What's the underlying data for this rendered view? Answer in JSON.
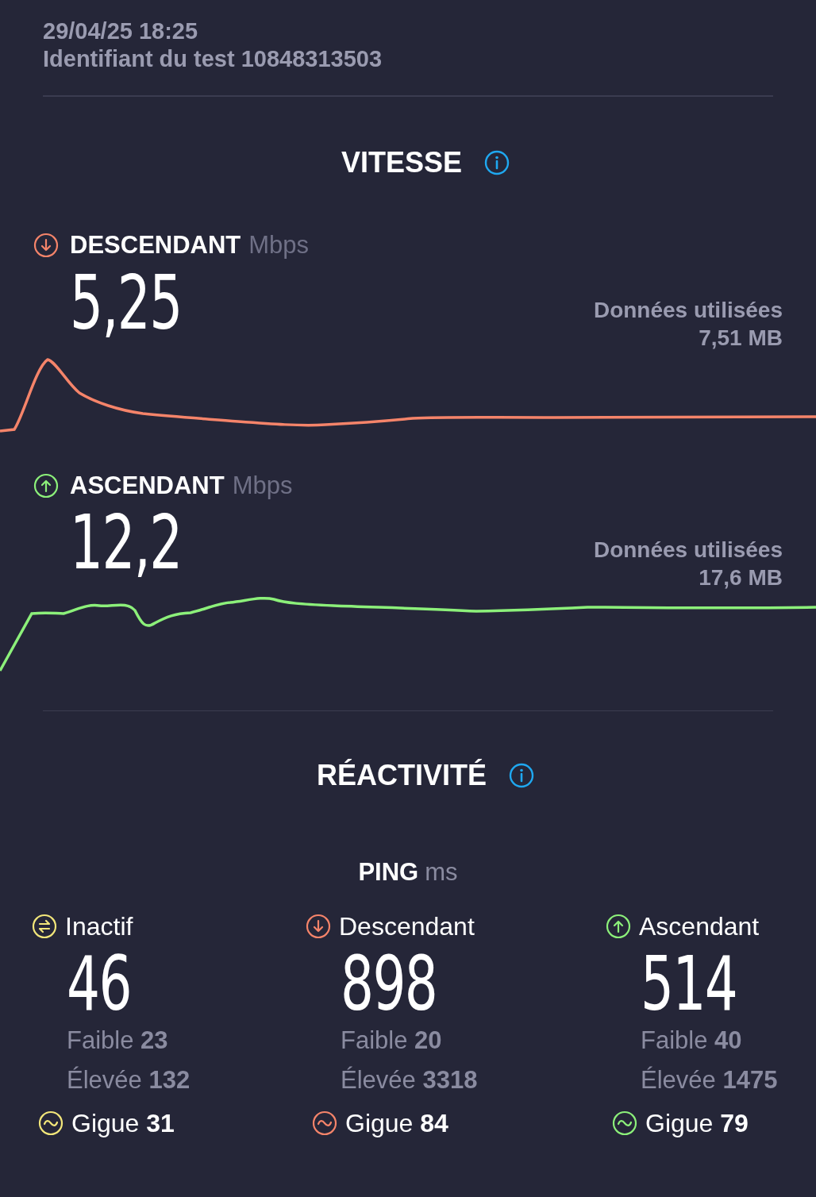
{
  "header": {
    "date": "29/04/25 18:25",
    "test_id": "Identifiant du test 10848313503"
  },
  "speed": {
    "title": "VITESSE",
    "items": [
      {
        "kind": "down",
        "label": "DESCENDANT",
        "unit": "Mbps",
        "value": "5,25",
        "data_label": "Données utilisées",
        "data_value": "7,51 MB"
      },
      {
        "kind": "up",
        "label": "ASCENDANT",
        "unit": "Mbps",
        "value": "12,2",
        "data_label": "Données utilisées",
        "data_value": "17,6 MB"
      }
    ]
  },
  "responsiveness": {
    "title": "RÉACTIVITÉ",
    "ping_label": "PING",
    "ping_unit": "ms",
    "columns": [
      {
        "kind": "idle",
        "label": "Inactif",
        "value": "46",
        "low_label": "Faible",
        "low_value": "23",
        "high_label": "Élevée",
        "high_value": "132",
        "jitter_label": "Gigue",
        "jitter_value": "31"
      },
      {
        "kind": "down",
        "label": "Descendant",
        "value": "898",
        "low_label": "Faible",
        "low_value": "20",
        "high_label": "Élevée",
        "high_value": "3318",
        "jitter_label": "Gigue",
        "jitter_value": "84"
      },
      {
        "kind": "up",
        "label": "Ascendant",
        "value": "514",
        "low_label": "Faible",
        "low_value": "40",
        "high_label": "Élevée",
        "high_value": "1475",
        "jitter_label": "Gigue",
        "jitter_value": "79"
      }
    ]
  }
}
